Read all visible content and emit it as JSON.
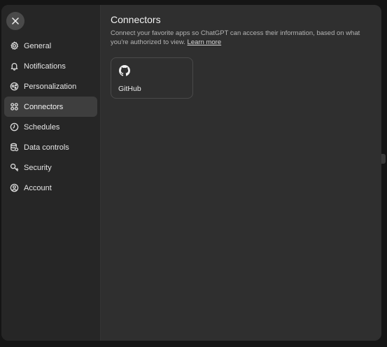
{
  "sidebar": {
    "close_icon": "close-icon",
    "items": [
      {
        "label": "General",
        "icon": "gear-icon"
      },
      {
        "label": "Notifications",
        "icon": "bell-icon"
      },
      {
        "label": "Personalization",
        "icon": "personalization-icon"
      },
      {
        "label": "Connectors",
        "icon": "connectors-icon",
        "active": true
      },
      {
        "label": "Schedules",
        "icon": "clock-icon"
      },
      {
        "label": "Data controls",
        "icon": "database-icon"
      },
      {
        "label": "Security",
        "icon": "key-icon"
      },
      {
        "label": "Account",
        "icon": "user-circle-icon"
      }
    ]
  },
  "main": {
    "title": "Connectors",
    "description": "Connect your favorite apps so ChatGPT can access their information, based on what you're authorized to view.",
    "learn_more": "Learn more",
    "connectors": [
      {
        "label": "GitHub",
        "icon": "github-icon"
      }
    ]
  },
  "colors": {
    "background": "#151515",
    "modal": "#2f2f2f",
    "sidebar": "#262626",
    "active_item": "#3e3e3e",
    "card_border": "#4a4a4a"
  }
}
